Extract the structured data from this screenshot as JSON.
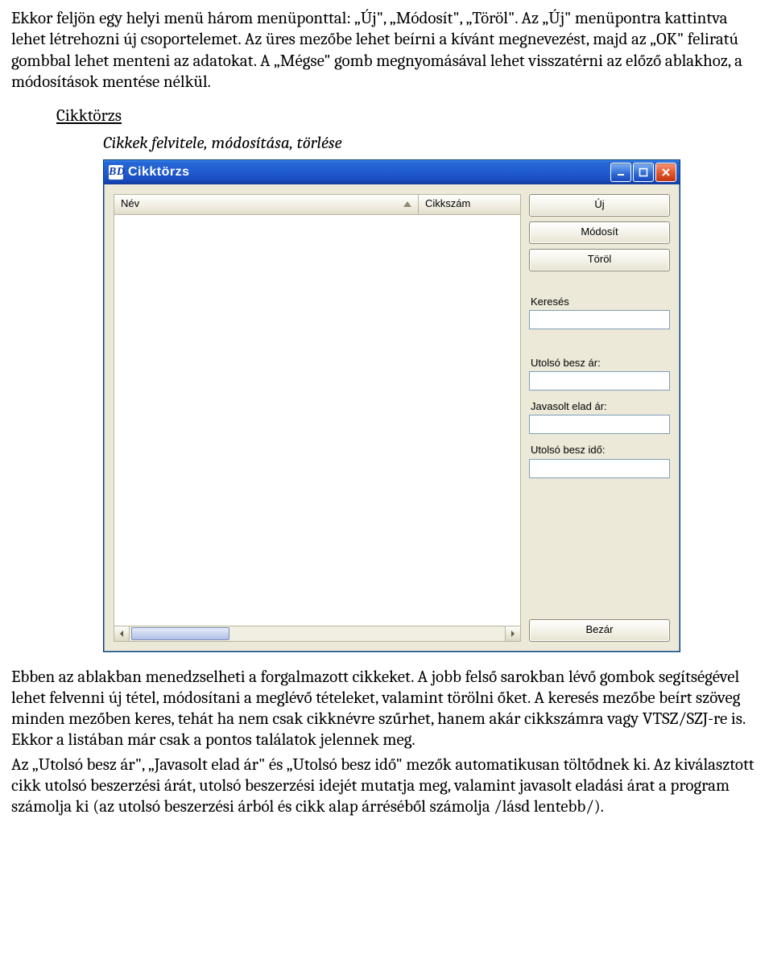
{
  "text": {
    "para1": "Ekkor feljön egy helyi menü három menüponttal: „Új\", „Módosít\", „Töröl\". Az „Új\" menüpontra kattintva lehet létrehozni új csoportelemet. Az üres mezőbe lehet beírni a kívánt megnevezést, majd az „OK\" feliratú gombbal lehet menteni az adatokat. A „Mégse\" gomb megnyomásával lehet visszatérni az előző ablakhoz, a módosítások mentése nélkül.",
    "section": "Cikktörzs",
    "subsection": "Cikkek felvitele, módosítása, törlése",
    "para2": "Ebben az ablakban menedzselheti a forgalmazott cikkeket. A jobb felső sarokban lévő gombok segítségével lehet felvenni új tétel, módosítani a meglévő tételeket, valamint törölni őket. A keresés mezőbe beírt szöveg minden mezőben keres, tehát ha nem csak cikknévre szűrhet, hanem akár cikkszámra vagy VTSZ/SZJ-re is. Ekkor a listában már csak a pontos találatok jelennek meg.",
    "para3": "Az „Utolsó besz ár\", „Javasolt elad ár\" és „Utolsó besz idő\" mezők automatikusan töltődnek ki. Az kiválasztott cikk utolsó beszerzési árát, utolsó beszerzési idejét mutatja meg, valamint javasolt eladási árat a program számolja ki (az utolsó beszerzési árból és cikk alap árréséből számolja /lásd lentebb/)."
  },
  "window": {
    "app_icon_text": "BD",
    "title": "Cikktörzs",
    "columns": {
      "nev": "Név",
      "cikkszam": "Cikkszám"
    },
    "buttons": {
      "uj": "Új",
      "modosit": "Módosít",
      "torol": "Töröl",
      "bezar": "Bezár"
    },
    "labels": {
      "kereses": "Keresés",
      "utolso_besz_ar": "Utolsó besz ár:",
      "javasolt_elad_ar": "Javasolt elad ár:",
      "utolso_besz_ido": "Utolsó besz idő:"
    }
  }
}
